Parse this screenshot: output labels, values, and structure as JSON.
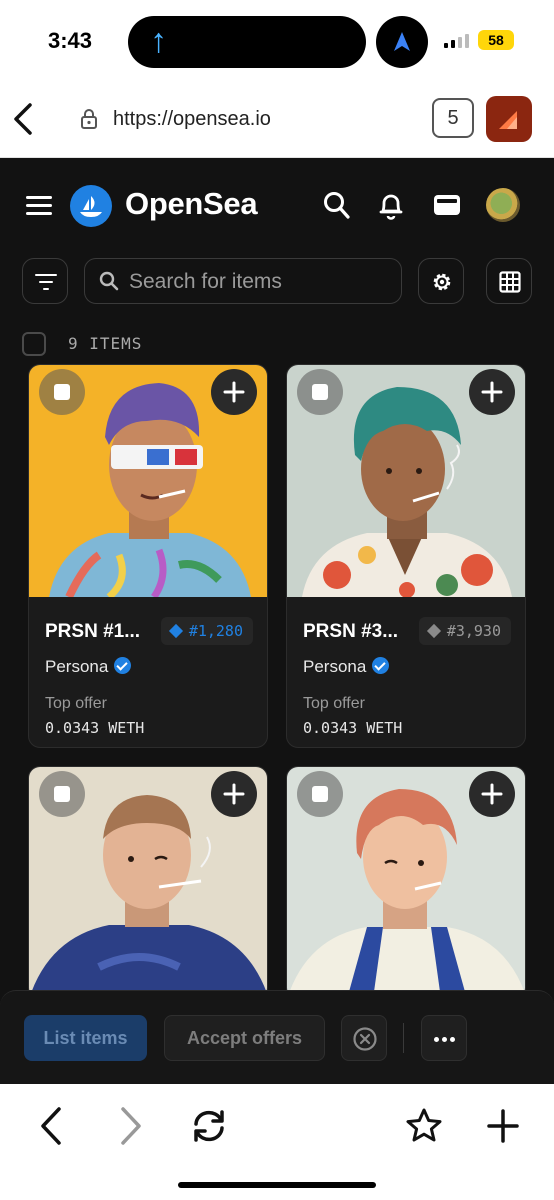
{
  "status_bar": {
    "time": "3:43",
    "battery": "58"
  },
  "browser": {
    "url": "https://opensea.io",
    "tab_count": "5"
  },
  "app": {
    "brand": "OpenSea",
    "search": {
      "placeholder": "Search for items"
    },
    "items_count": "9 ITEMS"
  },
  "cards": [
    {
      "name": "PRSN #1...",
      "rank": "#1,280",
      "rank_color": "#2081e2",
      "collection": "Persona",
      "offer_label": "Top offer",
      "offer_value": "0.0343 WETH"
    },
    {
      "name": "PRSN #3...",
      "rank": "#3,930",
      "rank_color": "#8a8a8a",
      "collection": "Persona",
      "offer_label": "Top offer",
      "offer_value": "0.0343 WETH"
    },
    {
      "name": "",
      "rank": "",
      "collection": "",
      "offer_label": "",
      "offer_value": ""
    },
    {
      "name": "",
      "rank": "",
      "collection": "",
      "offer_label": "",
      "offer_value": ""
    }
  ],
  "actions": {
    "list_items": "List items",
    "accept_offers": "Accept offers"
  },
  "colors": {
    "accent": "#2081e2",
    "background": "#121212",
    "card": "#1b1b1b"
  }
}
